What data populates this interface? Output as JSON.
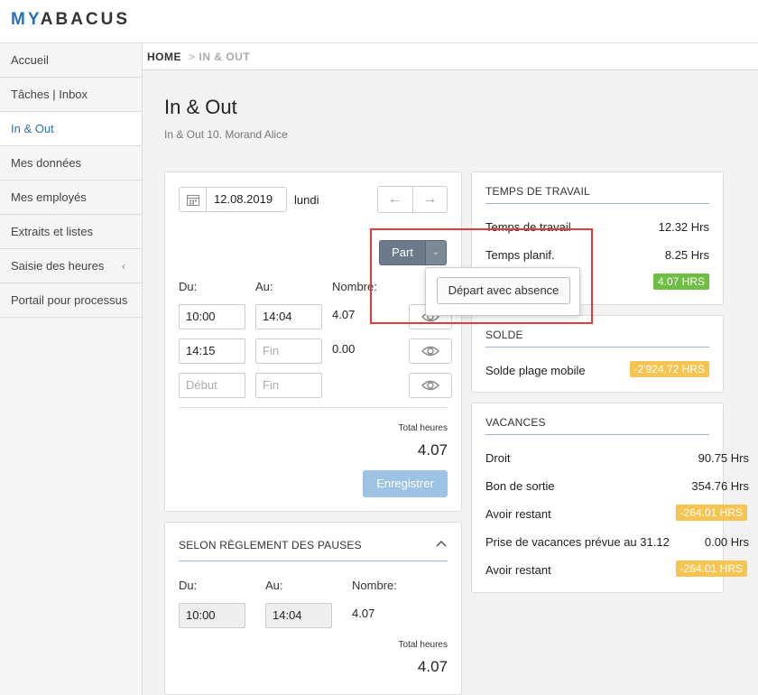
{
  "brand": {
    "prefix": "MY",
    "suffix": "ABACUS"
  },
  "sidebar": {
    "items": [
      {
        "label": "Accueil"
      },
      {
        "label": "Tâches | Inbox"
      },
      {
        "label": "In & Out"
      },
      {
        "label": "Mes données"
      },
      {
        "label": "Mes employés"
      },
      {
        "label": "Extraits et listes"
      },
      {
        "label": "Saisie des heures"
      },
      {
        "label": "Portail pour processus"
      }
    ],
    "active_index": 2,
    "expander_glyph": "‹"
  },
  "breadcrumb": {
    "home": "HOME",
    "separator": ">",
    "current": "IN & OUT"
  },
  "page": {
    "title": "In & Out",
    "subtitle": "In & Out 10. Morand Alice"
  },
  "entry": {
    "date": "12.08.2019",
    "weekday": "lundi",
    "part_label": "Part",
    "columns": {
      "from": "Du:",
      "to": "Au:",
      "count": "Nombre:"
    },
    "rows": [
      {
        "from": "10:00",
        "to": "14:04",
        "count": "4.07"
      },
      {
        "from": "14:15",
        "to": "",
        "count": "0.00"
      },
      {
        "from": "",
        "to": "",
        "count": ""
      }
    ],
    "placeholders": {
      "from": "Début",
      "to": "Fin"
    },
    "total_label": "Total heures",
    "total_value": "4.07",
    "save_label": "Enregistrer"
  },
  "dropdown": {
    "item": "Départ avec absence"
  },
  "pauses": {
    "title": "SELON RÈGLEMENT DES PAUSES",
    "columns": {
      "from": "Du:",
      "to": "Au:",
      "count": "Nombre:"
    },
    "row": {
      "from": "10:00",
      "to": "14:04",
      "count": "4.07"
    },
    "total_label": "Total heures",
    "total_value": "4.07"
  },
  "work_time": {
    "title": "TEMPS DE TRAVAIL",
    "rows": [
      {
        "label": "Temps de travail",
        "value": "12.32 Hrs"
      },
      {
        "label": "Temps planif.",
        "value": "8.25 Hrs"
      }
    ],
    "badge": "4.07 HRS"
  },
  "balance": {
    "title": "SOLDE",
    "label": "Solde plage mobile",
    "badge": "-2'924.72 HRS"
  },
  "vacation": {
    "title": "VACANCES",
    "rows": [
      {
        "label": "Droit",
        "value": "90.75 Hrs"
      },
      {
        "label": "Bon de sortie",
        "value": "354.76 Hrs"
      },
      {
        "label": "Avoir restant",
        "badge": "-264.01 HRS"
      },
      {
        "label": "Prise de vacances prévue au 31.12",
        "value": "0.00 Hrs"
      },
      {
        "label": "Avoir restant",
        "badge": "-264.01 HRS"
      }
    ]
  },
  "colors": {
    "accent": "#2a6fb5",
    "badge_green": "#6fbe44",
    "badge_orange": "#f6c453",
    "highlight_red": "#e23b3b",
    "save_button": "#9cc2e5",
    "part_button": "#6c7a89"
  }
}
